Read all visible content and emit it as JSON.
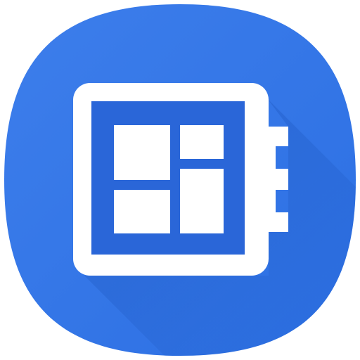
{
  "icon": {
    "name": "widget-board-app-icon",
    "background_color": "#2C6FE3",
    "background_highlight": "#3D7EEB",
    "shadow_color": "#1F59C2",
    "foreground_color": "#FFFFFF",
    "inner_panel_color": "#2A66D8",
    "glyphs": [
      "device-frame-icon",
      "tile-grid-icon",
      "connector-pins-icon"
    ]
  }
}
